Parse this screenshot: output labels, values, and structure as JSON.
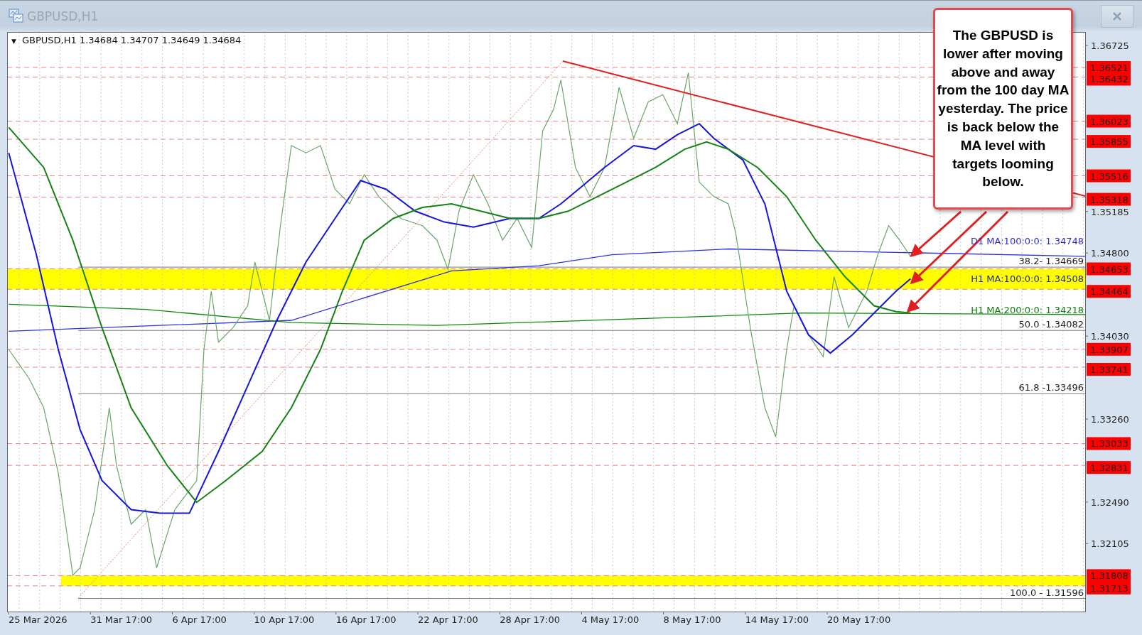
{
  "window": {
    "title": "GBPUSD,H1"
  },
  "chart": {
    "menu_glyph": "▼",
    "symbol": "GBPUSD,H1",
    "ohlc": [
      "1.34684",
      "1.34707",
      "1.34649",
      "1.34684"
    ],
    "price_axis": [
      "1.36725",
      "1.35185",
      "1.34800",
      "1.34030",
      "1.33260",
      "1.32490",
      "1.32105"
    ],
    "level_labels": [
      {
        "price": "1.36521",
        "zone_edge": false
      },
      {
        "price": "1.36432",
        "zone_edge": false
      },
      {
        "price": "1.36023",
        "zone_edge": false
      },
      {
        "price": "1.35855",
        "zone_edge": false
      },
      {
        "price": "1.35516",
        "zone_edge": false
      },
      {
        "price": "1.35318",
        "zone_edge": false
      },
      {
        "price": "1.34653",
        "zone_edge": true
      },
      {
        "price": "1.34464",
        "zone_edge": true
      },
      {
        "price": "1.33907",
        "zone_edge": false
      },
      {
        "price": "1.33741",
        "zone_edge": false
      },
      {
        "price": "1.33033",
        "zone_edge": false
      },
      {
        "price": "1.32831",
        "zone_edge": false
      },
      {
        "price": "1.31808",
        "zone_edge": true
      },
      {
        "price": "1.31713",
        "zone_edge": true
      }
    ],
    "fib_levels": [
      "38.2- 1.34669",
      "50.0 -1.34082",
      "61.8 -1.33496",
      "100.0 - 1.31596"
    ],
    "ma_labels": [
      {
        "text": "D1 MA:100:0:0: 1.34748",
        "color": "#2b2bd6"
      },
      {
        "text": "H1 MA:100:0:0: 1.34508",
        "color": "#1c2a6e"
      },
      {
        "text": "H1 MA:200:0:0: 1.34218",
        "color": "#0a7a0a"
      }
    ],
    "time_axis": [
      "25 Mar 2026",
      "31 Mar 17:00",
      "6 Apr 17:00",
      "10 Apr 17:00",
      "16 Apr 17:00",
      "22 Apr 17:00",
      "28 Apr 17:00",
      "4 May 17:00",
      "8 May 17:00",
      "14 May 17:00",
      "20 May 17:00"
    ]
  },
  "annotation": {
    "text": "The GBPUSD is lower after moving above and away from the 100 day MA yesterday. The price is back below the MA level with targets looming below."
  }
}
